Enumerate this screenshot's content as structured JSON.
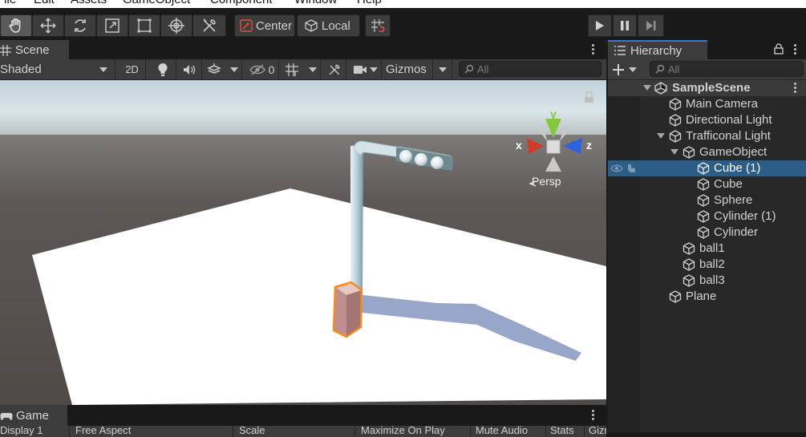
{
  "menu": [
    "File",
    "Edit",
    "Assets",
    "GameObject",
    "Component",
    "Window",
    "Help"
  ],
  "toolbar": {
    "tools": [
      "hand-tool",
      "move-tool",
      "rotate-tool",
      "scale-tool",
      "rect-tool",
      "transform-tool",
      "custom-editor-tool"
    ],
    "pivot_label": "Center",
    "space_label": "Local",
    "snap_icon": "grid-snap-icon"
  },
  "scene": {
    "tab_label": "Scene",
    "draw_mode": "Shaded",
    "mode_2d": "2D",
    "hidden_count": "0",
    "gizmos_label": "Gizmos",
    "search_placeholder": "All",
    "persp_label": "Persp",
    "axis_x": "x",
    "axis_y": "y",
    "axis_z": "z"
  },
  "game": {
    "tab_label": "Game",
    "toolbar_items": [
      "Display 1",
      "Free Aspect",
      "Scale",
      "Maximize On Play",
      "Mute Audio",
      "Stats",
      "Gizmos"
    ]
  },
  "hierarchy": {
    "tab_label": "Hierarchy",
    "search_placeholder": "All",
    "items": [
      {
        "label": "SampleScene",
        "depth": 0,
        "type": "scene",
        "expanded": true
      },
      {
        "label": "Main Camera",
        "depth": 1,
        "type": "object"
      },
      {
        "label": "Directional Light",
        "depth": 1,
        "type": "object"
      },
      {
        "label": "Trafficonal Light",
        "depth": 1,
        "type": "object",
        "expanded": true
      },
      {
        "label": "GameObject",
        "depth": 2,
        "type": "object",
        "expanded": true
      },
      {
        "label": "Cube (1)",
        "depth": 3,
        "type": "object",
        "selected": true
      },
      {
        "label": "Cube",
        "depth": 3,
        "type": "object"
      },
      {
        "label": "Sphere",
        "depth": 3,
        "type": "object"
      },
      {
        "label": "Cylinder (1)",
        "depth": 3,
        "type": "object"
      },
      {
        "label": "Cylinder",
        "depth": 3,
        "type": "object"
      },
      {
        "label": "ball1",
        "depth": 2,
        "type": "object"
      },
      {
        "label": "ball2",
        "depth": 2,
        "type": "object"
      },
      {
        "label": "ball3",
        "depth": 2,
        "type": "object"
      },
      {
        "label": "Plane",
        "depth": 1,
        "type": "object"
      }
    ]
  },
  "colors": {
    "selection": "#2c5d87",
    "outline": "#f58a1f",
    "axis_x": "#d13b2a",
    "axis_y": "#84c63c",
    "axis_z": "#2f62de",
    "sky": "#ccdde4",
    "ground": "#5e5955"
  }
}
